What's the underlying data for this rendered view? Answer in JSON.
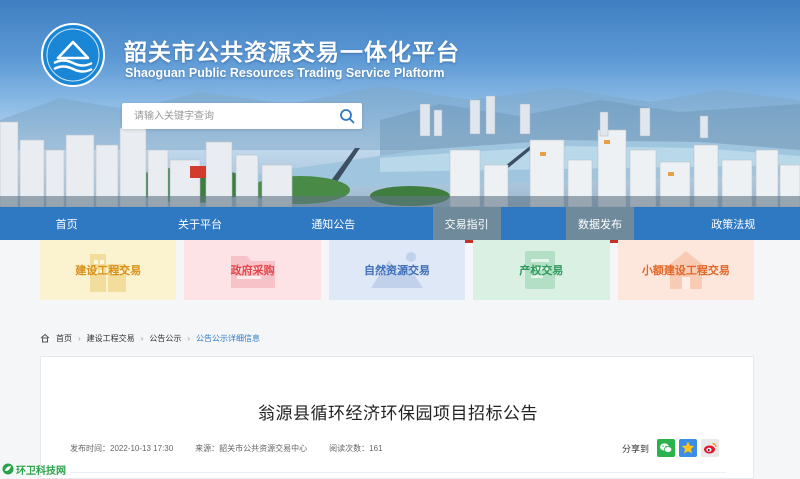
{
  "header": {
    "title": "韶关市公共资源交易一体化平台",
    "subtitle": "Shaoguan Public Resources Trading Service Plaftorm",
    "logo_icon": "river-mountain-logo-icon"
  },
  "search": {
    "placeholder": "请输入关键字查询",
    "button_icon": "search-icon"
  },
  "nav": {
    "items": [
      {
        "label": "首页",
        "active": false
      },
      {
        "label": "关于平台",
        "active": false
      },
      {
        "label": "通知公告",
        "active": false
      },
      {
        "label": "交易指引",
        "active": true
      },
      {
        "label": "数据发布",
        "active": true
      },
      {
        "label": "政策法规",
        "active": false
      }
    ]
  },
  "categories": [
    {
      "label": "建设工程交易",
      "bg": "#fbf3cf",
      "color": "#d9901a",
      "icon": "building-icon"
    },
    {
      "label": "政府采购",
      "bg": "#fde3e6",
      "color": "#e5484d",
      "icon": "folder-icon"
    },
    {
      "label": "自然资源交易",
      "bg": "#dfe8f6",
      "color": "#3f6fb8",
      "icon": "mountain-icon"
    },
    {
      "label": "产权交易",
      "bg": "#d9f0e3",
      "color": "#2f9a5b",
      "icon": "document-icon"
    },
    {
      "label": "小额建设工程交易",
      "bg": "#fde7dc",
      "color": "#e2672a",
      "icon": "house-icon"
    }
  ],
  "breadcrumb": {
    "home_icon": "home-icon",
    "items": [
      "首页",
      "建设工程交易",
      "公告公示",
      "公告公示详细信息"
    ]
  },
  "article": {
    "title": "翁源县循环经济环保园项目招标公告",
    "publish_time": "发布时间：2022-10-13 17:30",
    "source": "来源：韶关市公共资源交易中心",
    "views": "阅读次数：161",
    "share_label": "分享到"
  },
  "share_icons": [
    "wechat-icon",
    "qzone-icon",
    "weibo-icon"
  ],
  "watermark": {
    "text": "环卫科技网"
  },
  "colors": {
    "nav_bg": "#2f79c3",
    "nav_active_bg": "#6f8a9b",
    "nav_active_underline": "#c4312a",
    "crumb_current": "#2f79c3"
  }
}
